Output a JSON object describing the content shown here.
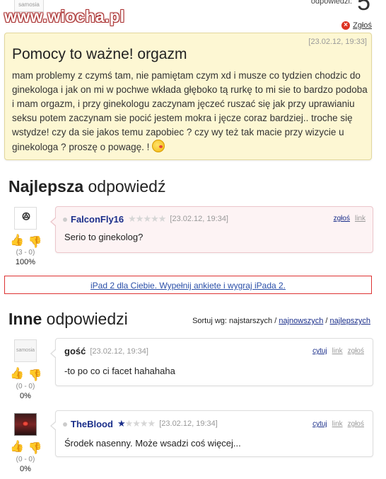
{
  "watermark": "www.wiocha.pl",
  "top_avatar_label": "samosia",
  "answers_count_label": "odpowiedzi:",
  "answers_count": "5",
  "report_label": "Zgłoś",
  "question": {
    "date": "[23.02.12, 19:33]",
    "title": "Pomocy to ważne! orgazm",
    "body": "mam problemy z czymś tam, nie pamiętam czym xd i musze co tydzien chodzic do ginekologa i jak on mi w pochwe wkłada głęboko tą rurkę to mi sie to bardzo podoba i mam orgazm, i przy ginekologu zaczynam jęczeć ruszać się jak przy uprawianiu seksu potem zaczynam sie pocić jestem mokra i jęcze coraz bardziej.. troche się wstydze! czy da sie jakos temu zapobiec ? czy wy też tak macie przy wizycie u ginekologa ? proszę o powagę. !"
  },
  "best": {
    "heading_bold": "Najlepsza",
    "heading_rest": " odpowiedź",
    "user": "FalconFly16",
    "rating": 0,
    "date": "[23.02.12, 19:34]",
    "report": "zgłoś",
    "link": "link",
    "text": "Serio to ginekolog?",
    "score": "(3 - 0)",
    "percent": "100%"
  },
  "promo": "iPad 2 dla Ciebie. Wypełnij ankiete i wygraj iPada 2.",
  "others": {
    "heading_bold": "Inne",
    "heading_rest": " odpowiedzi",
    "sort_label": "Sortuj wg: najstarszych /",
    "sort_newest": "najnowszych",
    "sort_sep": "/",
    "sort_best": "najlepszych",
    "answers": [
      {
        "user": "gość",
        "date": "[23.02.12, 19:34]",
        "quote": "cytuj",
        "link": "link",
        "report": "zgłoś",
        "text": "-to po co ci facet hahahaha",
        "score": "(0 - 0)",
        "percent": "0%",
        "avatar_label": "samosia"
      },
      {
        "user": "TheBlood",
        "rating": 1,
        "date": "[23.02.12, 19:34]",
        "quote": "cytuj",
        "link": "link",
        "report": "zgłoś",
        "text": "Środek nasenny. Może wsadzi coś więcej...",
        "score": "(0 - 0)",
        "percent": "0%"
      }
    ]
  },
  "colors": {
    "question_bg": "#fdf7d3",
    "best_bg": "#fdf3f4",
    "username": "#1a2e8a",
    "promo_border": "#dd3333",
    "thumb_up": "#d9479b",
    "thumb_down": "#e5a400"
  },
  "icons": [
    "report-icon",
    "thumb-up-icon",
    "thumb-down-icon",
    "star-icon",
    "blush-emoticon"
  ]
}
